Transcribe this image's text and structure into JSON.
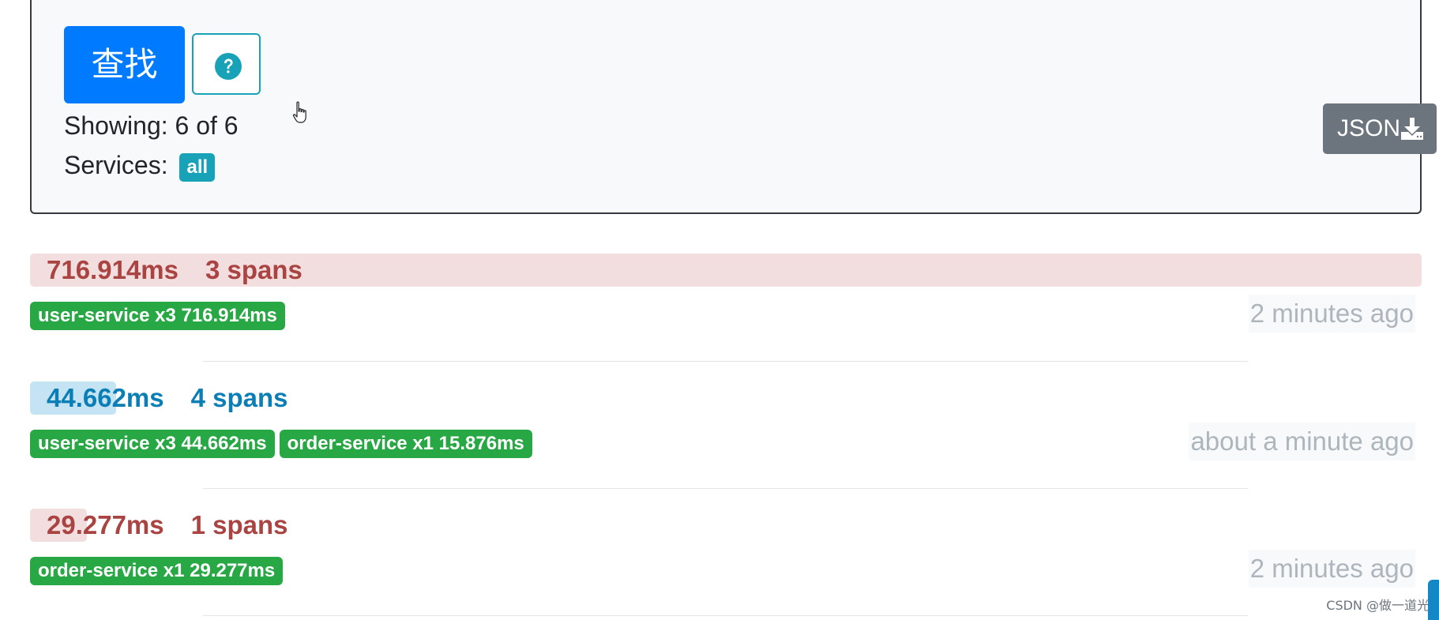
{
  "search_panel": {
    "find_button_label": "查找",
    "help_icon": "question-circle-icon",
    "showing_text": "Showing: 6 of 6",
    "services_label": "Services:",
    "services_badge": "all",
    "json_button_label": "JSON",
    "json_button_icon": "download-icon"
  },
  "traces": [
    {
      "duration": "716.914ms",
      "spans": "3 spans",
      "duration_fraction": 1.0,
      "tone": "danger",
      "services": [
        "user-service x3 716.914ms"
      ],
      "timestamp": "2 minutes ago"
    },
    {
      "duration": "44.662ms",
      "spans": "4 spans",
      "duration_fraction": 0.062,
      "tone": "info",
      "services": [
        "user-service x3 44.662ms",
        "order-service x1 15.876ms"
      ],
      "timestamp": "about a minute ago"
    },
    {
      "duration": "29.277ms",
      "spans": "1 spans",
      "duration_fraction": 0.041,
      "tone": "danger",
      "services": [
        "order-service x1 29.277ms"
      ],
      "timestamp": "2 minutes ago"
    }
  ],
  "watermark": "CSDN @做一道光",
  "colors": {
    "primary": "#007bff",
    "info": "#17a2b8",
    "success": "#28a745",
    "secondary": "#6c757d",
    "danger_text": "#a94442",
    "danger_bg": "#f2dede",
    "info_text": "#0b7fb5",
    "info_bg": "#c4e3f3"
  }
}
